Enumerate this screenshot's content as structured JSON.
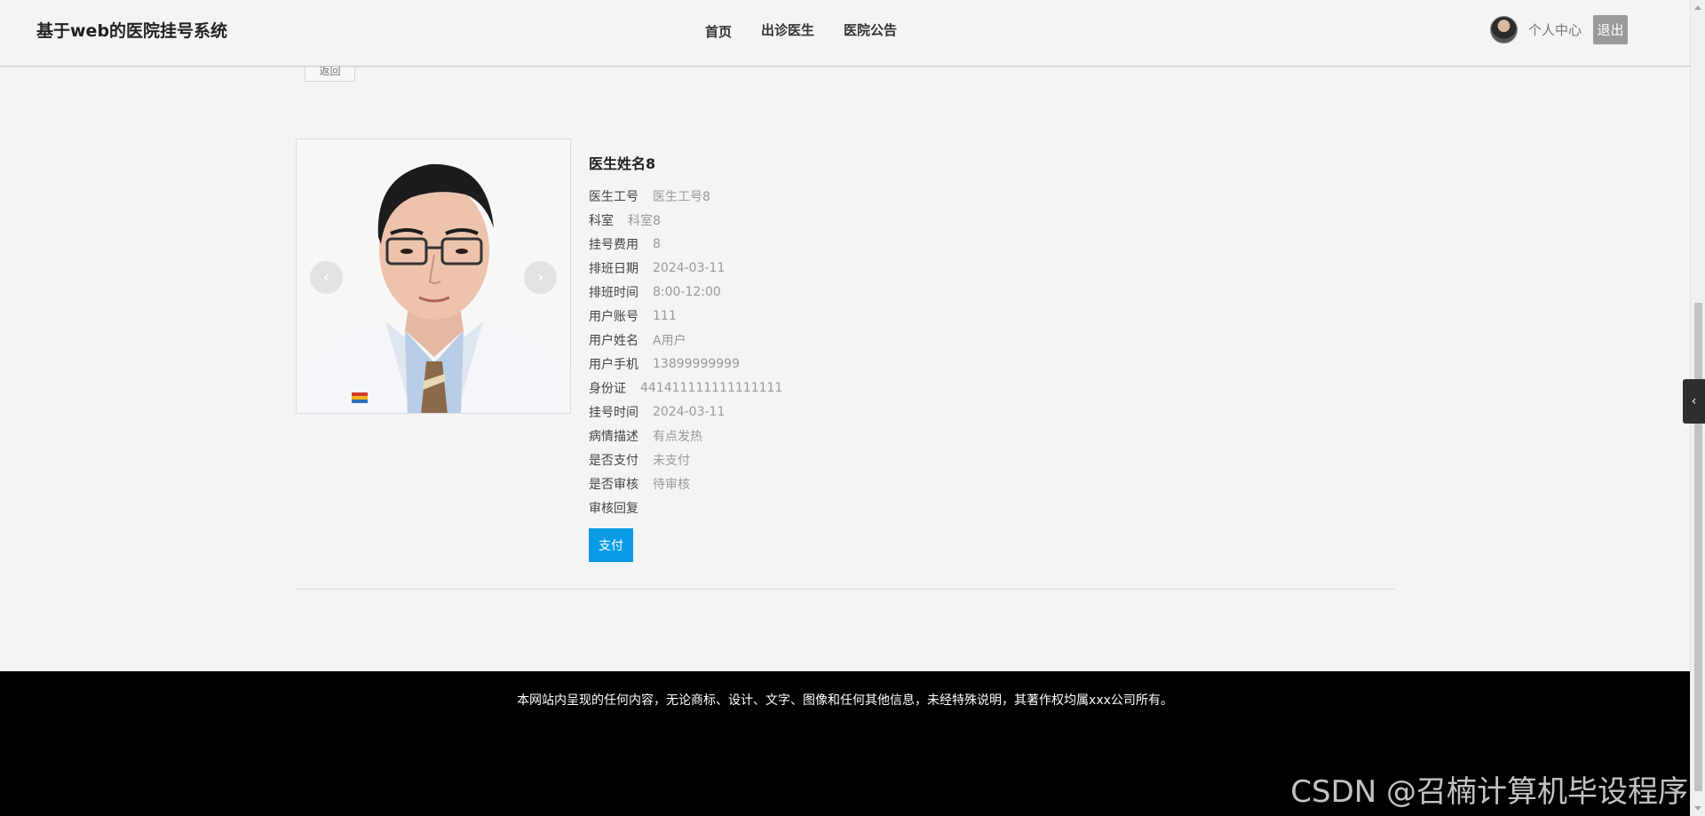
{
  "header": {
    "brand": "基于web的医院挂号系统",
    "nav": [
      {
        "label": "首页"
      },
      {
        "label": "出诊医生"
      },
      {
        "label": "医院公告"
      }
    ],
    "user_center": "个人中心",
    "logout": "退出"
  },
  "back_button": "返回",
  "carousel": {
    "prev_icon": "‹",
    "next_icon": "›"
  },
  "detail": {
    "doctor_name": "医生姓名8",
    "fields": [
      {
        "label": "医生工号",
        "value": "医生工号8"
      },
      {
        "label": "科室",
        "value": "科室8"
      },
      {
        "label": "挂号费用",
        "value": "8"
      },
      {
        "label": "排班日期",
        "value": "2024-03-11"
      },
      {
        "label": "排班时间",
        "value": "8:00-12:00"
      },
      {
        "label": "用户账号",
        "value": "111"
      },
      {
        "label": "用户姓名",
        "value": "A用户"
      },
      {
        "label": "用户手机",
        "value": "13899999999"
      },
      {
        "label": "身份证",
        "value": "441411111111111111"
      },
      {
        "label": "挂号时间",
        "value": "2024-03-11"
      },
      {
        "label": "病情描述",
        "value": "有点发热"
      },
      {
        "label": "是否支付",
        "value": "未支付"
      },
      {
        "label": "是否审核",
        "value": "待审核"
      },
      {
        "label": "审核回复",
        "value": ""
      }
    ],
    "pay_button": "支付"
  },
  "footer": {
    "copyright": "本网站内呈现的任何内容，无论商标、设计、文字、图像和任何其他信息，未经特殊说明，其著作权均属xxx公司所有。"
  },
  "watermark": "CSDN @召楠计算机毕设程序",
  "side_toggle_icon": "‹",
  "colors": {
    "accent": "#0b9be6",
    "footer_bg": "#000000",
    "page_bg": "#f4f4f4"
  }
}
